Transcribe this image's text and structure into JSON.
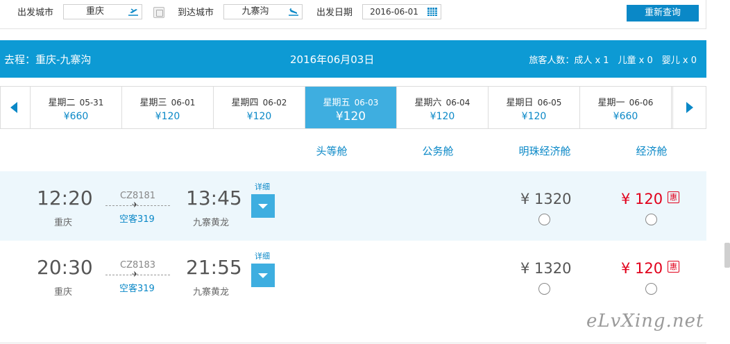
{
  "search": {
    "depart_label": "出发城市",
    "depart_value": "重庆",
    "arrive_label": "到达城市",
    "arrive_value": "九寨沟",
    "date_label": "出发日期",
    "date_value": "2016-06-01",
    "requery_label": "重新查询"
  },
  "route": {
    "title": "去程：重庆-九寨沟",
    "date": "2016年06月03日",
    "passengers": "旅客人数：成人 x 1　儿童 x 0　婴儿 x 0"
  },
  "date_strip": {
    "days": [
      {
        "weekday": "星期二",
        "date": "05-31",
        "price": "¥660",
        "active": false
      },
      {
        "weekday": "星期三",
        "date": "06-01",
        "price": "¥120",
        "active": false
      },
      {
        "weekday": "星期四",
        "date": "06-02",
        "price": "¥120",
        "active": false
      },
      {
        "weekday": "星期五",
        "date": "06-03",
        "price": "¥120",
        "active": true
      },
      {
        "weekday": "星期六",
        "date": "06-04",
        "price": "¥120",
        "active": false
      },
      {
        "weekday": "星期日",
        "date": "06-05",
        "price": "¥120",
        "active": false
      },
      {
        "weekday": "星期一",
        "date": "06-06",
        "price": "¥660",
        "active": false
      }
    ]
  },
  "cabins": {
    "first": "头等舱",
    "business": "公务舱",
    "pearl_economy": "明珠经济舱",
    "economy": "经济舱"
  },
  "flights": [
    {
      "dep_time": "12:20",
      "dep_city": "重庆",
      "flight_no": "CZ8181",
      "aircraft": "空客319",
      "arr_time": "13:45",
      "arr_city": "九寨黄龙",
      "detail_label": "详细",
      "pearl_price": "¥ 1320",
      "eco_price": "¥ 120",
      "discount_badge": "惠"
    },
    {
      "dep_time": "20:30",
      "dep_city": "重庆",
      "flight_no": "CZ8183",
      "aircraft": "空客319",
      "arr_time": "21:55",
      "arr_city": "九寨黄龙",
      "detail_label": "详细",
      "pearl_price": "¥ 1320",
      "eco_price": "¥ 120",
      "discount_badge": "惠"
    }
  ],
  "watermark": "eLvXing.net",
  "colors": {
    "primary": "#0a88c7",
    "header_bg": "#0d9ad4",
    "active_day": "#3eaee0",
    "row_highlight": "#edf7fc",
    "price_red": "#e1001b"
  },
  "icons": {
    "takeoff": "plane-takeoff-icon",
    "landing": "plane-landing-icon",
    "calendar": "calendar-icon",
    "swap": "swap-icon",
    "prev": "arrow-left-icon",
    "next": "arrow-right-icon",
    "expand": "chevron-down-icon",
    "plane": "plane-icon"
  }
}
